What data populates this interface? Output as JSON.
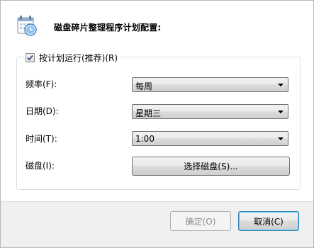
{
  "header": {
    "title": "磁盘碎片整理程序计划配置:",
    "icon": "calendar-clock-icon"
  },
  "schedule_group": {
    "checkbox_label": "按计划运行(推荐)(R)",
    "checked": true
  },
  "rows": {
    "frequency": {
      "label": "频率(F):",
      "value": "每周"
    },
    "day": {
      "label": "日期(D):",
      "value": "星期三"
    },
    "time": {
      "label": "时间(T):",
      "value": "1:00"
    },
    "disks": {
      "label": "磁盘(I):",
      "button": "选择磁盘(S)..."
    }
  },
  "footer": {
    "ok_label": "确定(O)",
    "cancel_label": "取消(C)"
  }
}
